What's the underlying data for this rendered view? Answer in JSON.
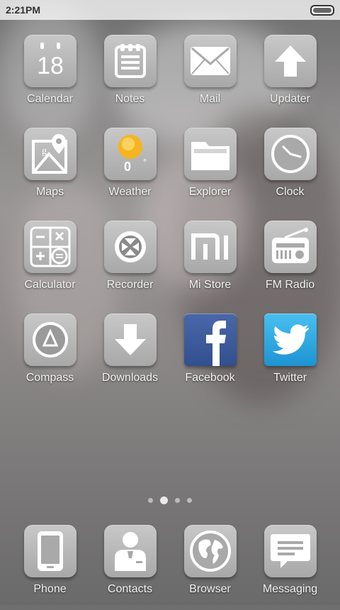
{
  "statusbar": {
    "time": "2:21PM"
  },
  "apps": [
    {
      "label": "Calendar",
      "icon": "calendar-icon",
      "badge": "18"
    },
    {
      "label": "Notes",
      "icon": "notes-icon"
    },
    {
      "label": "Mail",
      "icon": "mail-icon"
    },
    {
      "label": "Updater",
      "icon": "updater-icon"
    },
    {
      "label": "Maps",
      "icon": "maps-icon"
    },
    {
      "label": "Weather",
      "icon": "weather-icon",
      "temp": "0",
      "unit": "°"
    },
    {
      "label": "Explorer",
      "icon": "folder-icon"
    },
    {
      "label": "Clock",
      "icon": "clock-icon"
    },
    {
      "label": "Calculator",
      "icon": "calculator-icon"
    },
    {
      "label": "Recorder",
      "icon": "recorder-icon"
    },
    {
      "label": "Mi Store",
      "icon": "mi-store-icon"
    },
    {
      "label": "FM Radio",
      "icon": "radio-icon"
    },
    {
      "label": "Compass",
      "icon": "compass-icon"
    },
    {
      "label": "Downloads",
      "icon": "download-icon"
    },
    {
      "label": "Facebook",
      "icon": "facebook-icon"
    },
    {
      "label": "Twitter",
      "icon": "twitter-icon"
    }
  ],
  "dock": [
    {
      "label": "Phone",
      "icon": "phone-icon"
    },
    {
      "label": "Contacts",
      "icon": "contacts-icon"
    },
    {
      "label": "Browser",
      "icon": "globe-icon"
    },
    {
      "label": "Messaging",
      "icon": "message-icon"
    }
  ],
  "pager": {
    "pages": 4,
    "active": 2
  },
  "colors": {
    "facebook": "#3b5998",
    "twitter": "#2fa8e8",
    "weather_sun": "#f5b520"
  }
}
